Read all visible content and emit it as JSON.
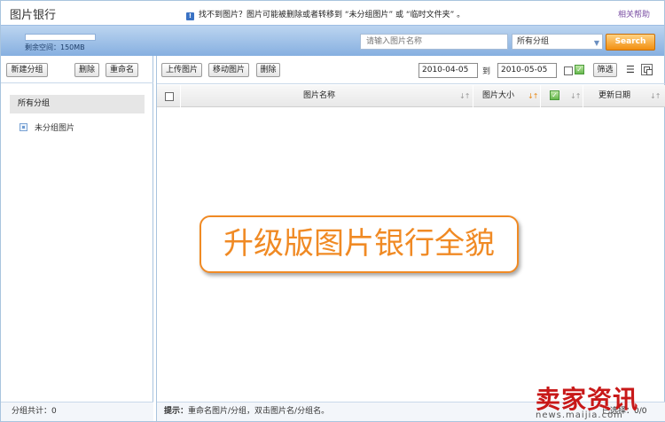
{
  "app": {
    "title": "图片银行",
    "notice": "找不到图片？图片可能被删除或者转移到 “未分组图片” 或 “临时文件夹” 。",
    "help_link": "相关帮助"
  },
  "storage": {
    "remaining_label": "剩余空间：150MB"
  },
  "search": {
    "placeholder": "请输入图片名称",
    "group_selected": "所有分组",
    "button_label": "Search"
  },
  "left_panel": {
    "toolbar": {
      "new_group": "新建分组",
      "delete": "删除",
      "rename": "重命名"
    },
    "tree": {
      "all_groups": "所有分组",
      "items": [
        {
          "label": "未分组图片"
        }
      ]
    },
    "footer": "分组共计：0"
  },
  "main_panel": {
    "toolbar": {
      "upload": "上传图片",
      "move": "移动图片",
      "delete": "删除",
      "date_from": "2010-04-05",
      "to_label": "到",
      "date_to": "2010-05-05",
      "filter": "筛选"
    },
    "table": {
      "columns": {
        "name": "图片名称",
        "size": "图片大小",
        "updated": "更新日期"
      },
      "rows": []
    },
    "overlay_banner": "升级版图片银行全貌",
    "footer": {
      "tip_label": "提示：",
      "tip_text": "重命名图片/分组，双击图片名/分组名。",
      "selected": "已选择：0/0"
    }
  },
  "watermark": {
    "logo_text": "卖家资讯",
    "url": "news.maijia.com"
  },
  "icons": {
    "info": "info-icon",
    "folder": "folder-icon",
    "check": "check-icon",
    "list_view": "list-view-icon",
    "grid_view": "grid-view-icon",
    "sort": "sort-icon",
    "caret": "chevron-down-icon"
  },
  "colors": {
    "accent_orange": "#f08a24",
    "header_blue": "#86afe0",
    "border_blue": "#a9c4de",
    "logo_red": "#c81818"
  }
}
